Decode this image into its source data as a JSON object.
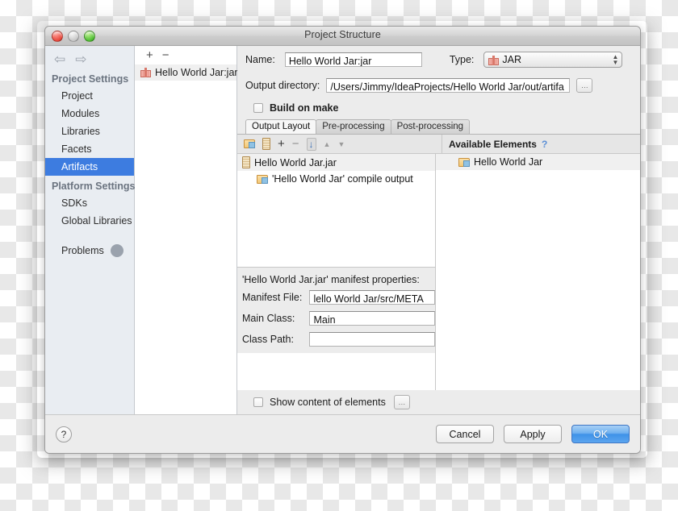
{
  "window": {
    "title": "Project Structure",
    "traffic_lights": [
      "close-button",
      "minimize-button",
      "zoom-button"
    ]
  },
  "nav": {
    "back": "⇦",
    "forward": "⇨"
  },
  "sidebar": {
    "groups": [
      {
        "header": "Project Settings",
        "items": [
          {
            "label": "Project",
            "selected": false
          },
          {
            "label": "Modules",
            "selected": false
          },
          {
            "label": "Libraries",
            "selected": false
          },
          {
            "label": "Facets",
            "selected": false
          },
          {
            "label": "Artifacts",
            "selected": true
          }
        ]
      },
      {
        "header": "Platform Settings",
        "items": [
          {
            "label": "SDKs",
            "selected": false
          },
          {
            "label": "Global Libraries",
            "selected": false
          }
        ]
      }
    ],
    "problems_label": "Problems"
  },
  "artifact_list": {
    "add_label": "+",
    "remove_label": "−",
    "items": [
      {
        "label": "Hello World Jar:jar",
        "icon": "jar-artifact-icon",
        "selected": true
      }
    ]
  },
  "detail": {
    "name_label": "Name:",
    "name_value": "Hello World Jar:jar",
    "type_label": "Type:",
    "type_value": "JAR",
    "output_dir_label": "Output directory:",
    "output_dir_value": "/Users/Jimmy/IdeaProjects/Hello World Jar/out/artifa",
    "browse_label": "…",
    "build_on_make_label": "Build on make",
    "build_on_make_checked": false,
    "tabs": [
      {
        "label": "Output Layout",
        "active": true
      },
      {
        "label": "Pre-processing",
        "active": false
      },
      {
        "label": "Post-processing",
        "active": false
      }
    ],
    "toolbar": [
      {
        "name": "create-directory-icon",
        "glyph": "📁"
      },
      {
        "name": "create-archive-icon",
        "glyph": "▥"
      },
      {
        "name": "add-icon",
        "glyph": "+"
      },
      {
        "name": "remove-icon",
        "glyph": "−"
      },
      {
        "name": "sort-alphabetically-icon",
        "glyph": "↓"
      },
      {
        "name": "move-up-icon",
        "glyph": "▲"
      },
      {
        "name": "move-down-icon",
        "glyph": "▼"
      }
    ],
    "available_elements_label": "Available Elements",
    "help_hint": "?",
    "output_tree": [
      {
        "label": "Hello World Jar.jar",
        "icon": "jar-icon",
        "depth": 0,
        "selected": true
      },
      {
        "label": "'Hello World Jar' compile output",
        "icon": "compile-output-folder-icon",
        "depth": 1,
        "selected": false
      }
    ],
    "available_tree": [
      {
        "label": "Hello World Jar",
        "icon": "module-folder-icon",
        "depth": 0
      }
    ],
    "manifest": {
      "title": "'Hello World Jar.jar' manifest properties:",
      "fields": [
        {
          "label": "Manifest File:",
          "value": "lello World Jar/src/META"
        },
        {
          "label": "Main Class:",
          "value": "Main"
        },
        {
          "label": "Class Path:",
          "value": ""
        }
      ],
      "show_content_label": "Show content of elements",
      "show_content_checked": false,
      "show_content_browse": "…"
    }
  },
  "footer": {
    "help_label": "?",
    "buttons": [
      {
        "label": "Cancel",
        "primary": false
      },
      {
        "label": "Apply",
        "primary": false
      },
      {
        "label": "OK",
        "primary": true
      }
    ]
  }
}
